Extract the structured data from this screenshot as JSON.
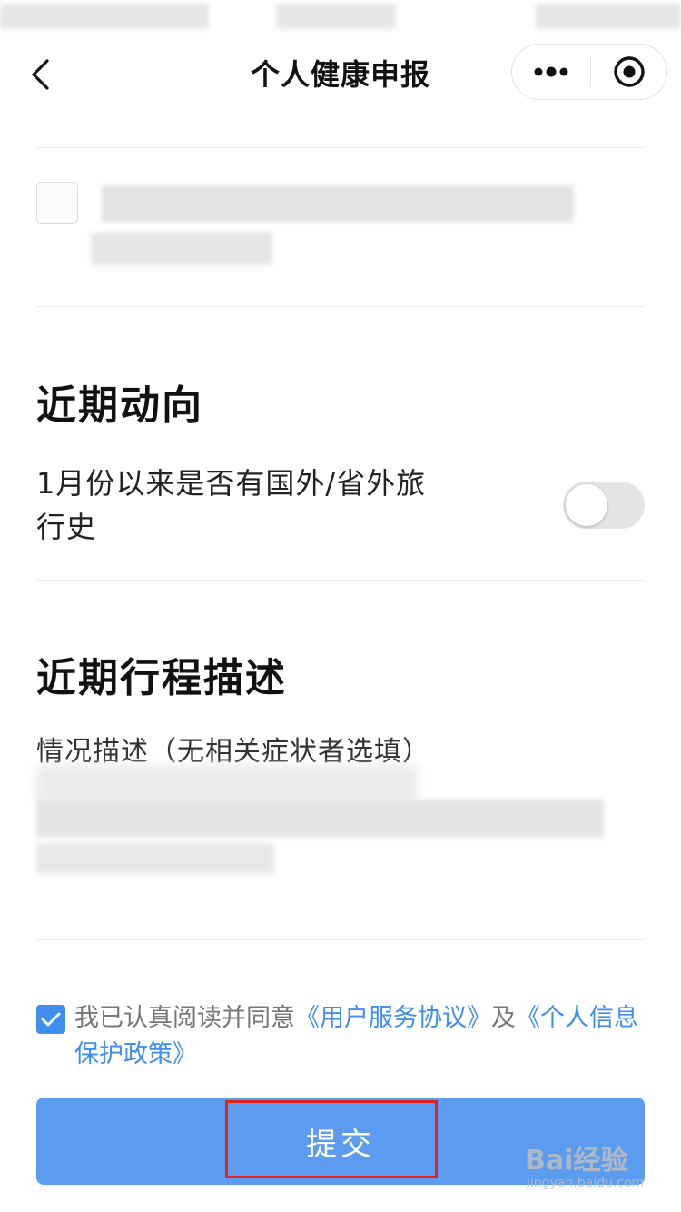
{
  "nav": {
    "title": "个人健康申报",
    "back_icon": "chevron-left-icon",
    "more_icon": "more-dots-icon",
    "close_icon": "target-circle-icon"
  },
  "sections": {
    "recent_movement": {
      "title": "近期动向",
      "question": "1月份以来是否有国外/省外旅行史",
      "toggle_on": false
    },
    "itinerary": {
      "title": "近期行程描述",
      "field_label": "情况描述（无相关症状者选填）"
    }
  },
  "agreement": {
    "checked": true,
    "prefix": "我已认真阅读并同意",
    "link1": "《用户服务协议》",
    "middle": "及",
    "link2": "《个人信息保护政策》"
  },
  "submit": {
    "label": "提交"
  },
  "watermark": {
    "brand": "Bai经验",
    "url": "jingyan.baidu.com"
  },
  "colors": {
    "accent": "#3f8ef0",
    "button": "#5b9cf0",
    "highlight": "#e0241b",
    "toggle_off": "#e4e4e4"
  }
}
